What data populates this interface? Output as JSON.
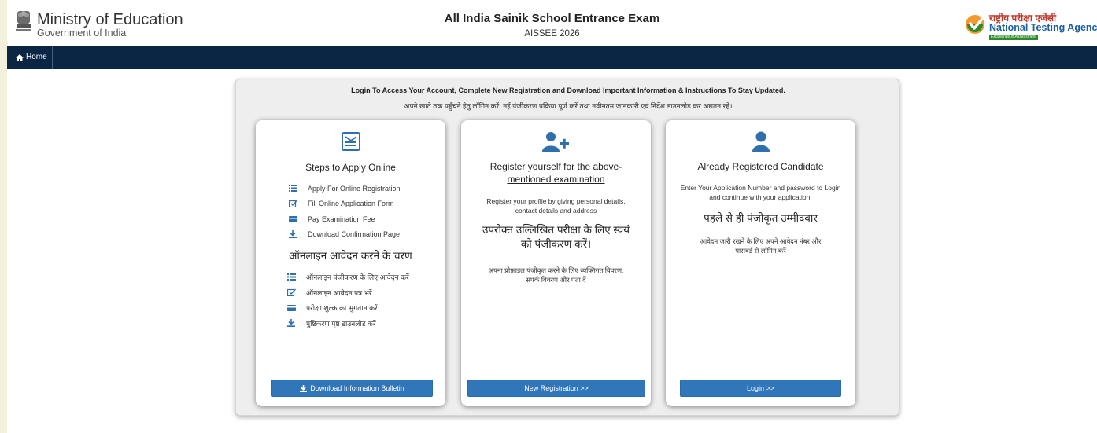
{
  "header": {
    "ministry_title": "Ministry of Education",
    "ministry_subtitle": "Government of India",
    "exam_title": "All India Sainik School Entrance Exam",
    "exam_code": "AISSEE 2026",
    "nta_hindi": "राष्ट्रीय परीक्षा एजेंसी",
    "nta_english": "National Testing Agency",
    "nta_tagline": "Excellence in Assessment"
  },
  "nav": {
    "home_label": "Home",
    "home_icon": "home-icon"
  },
  "intro": {
    "english": "Login To Access Your Account, Complete New Registration and Download Important Information & Instructions To Stay Updated.",
    "hindi": "अपने खाते तक पहुँचने हेतु लॉगिन करें, नई पंजीकरण प्रक्रिया पूर्ण करें तथा नवीनतम जानकारी एवं निर्देश डाउनलोड कर अद्यतन रहें।"
  },
  "steps_card": {
    "icon": "form-icon",
    "title": "Steps to Apply Online",
    "steps_en": [
      {
        "icon": "list-icon",
        "label": "Apply For Online Registration"
      },
      {
        "icon": "edit-icon",
        "label": "Fill Online Application Form"
      },
      {
        "icon": "card-icon",
        "label": "Pay Examination Fee"
      },
      {
        "icon": "download-icon",
        "label": "Download Confirmation Page"
      }
    ],
    "title_hi": "ऑनलाइन आवेदन करने के चरण",
    "steps_hi": [
      {
        "icon": "list-icon",
        "label": "ऑनलाइन पंजीकरण के लिए आवेदन करें"
      },
      {
        "icon": "edit-icon",
        "label": "ऑनलाइन आवेदन पत्र भरें"
      },
      {
        "icon": "card-icon",
        "label": "परीक्षा शुल्क का भुगतान करें"
      },
      {
        "icon": "download-icon",
        "label": "पुष्टिकरण पृष्ठ डाउनलोड करें"
      }
    ],
    "button": "Download Information Bulletin"
  },
  "register_card": {
    "icon": "add-user-icon",
    "title": "Register yourself for the above-mentioned examination",
    "text_en": "Register your profile by giving personal details, contact details and address",
    "title_hi": "उपरोक्त उल्लिखित परीक्षा के लिए स्वयं को पंजीकरण करें।",
    "text_hi": "अपना प्रोफ़ाइल पंजीकृत करने के लिए व्यक्तिगत विवरण, संपर्क विवरण और पता दें",
    "button": "New Registration >>"
  },
  "login_card": {
    "icon": "user-icon",
    "title": "Already Registered Candidate",
    "text_en": "Enter Your Application Number and password to Login and continue with your application.",
    "title_hi": "पहले से ही पंजीकृत उम्मीदवार",
    "text_hi": "आवेदन जारी रखने के लिए अपने आवेदन नंबर और पासवर्ड से लॉगिन करें",
    "button": "Login >>"
  },
  "colors": {
    "navbar": "#0b2545",
    "button": "#3176b8",
    "icon_blue": "#2f6fab"
  }
}
